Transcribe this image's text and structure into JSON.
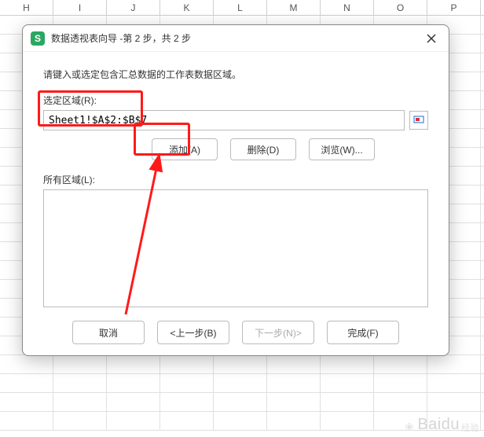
{
  "columns": [
    "H",
    "I",
    "J",
    "K",
    "L",
    "M",
    "N",
    "O",
    "P"
  ],
  "dialog": {
    "title": "数据透视表向导 -第 2 步，共 2 步",
    "instruction": "请键入或选定包含汇总数据的工作表数据区域。",
    "range_label": "选定区域(R):",
    "range_value": "Sheet1!$A$2:$B$7",
    "add_label": "添加(A)",
    "delete_label": "删除(D)",
    "browse_label": "浏览(W)...",
    "all_label": "所有区域(L):",
    "cancel_label": "取消",
    "prev_label": "<上一步(B)",
    "next_label": "下一步(N)>",
    "finish_label": "完成(F)"
  },
  "watermark": {
    "brand": "Baidu",
    "sub": "经验"
  }
}
